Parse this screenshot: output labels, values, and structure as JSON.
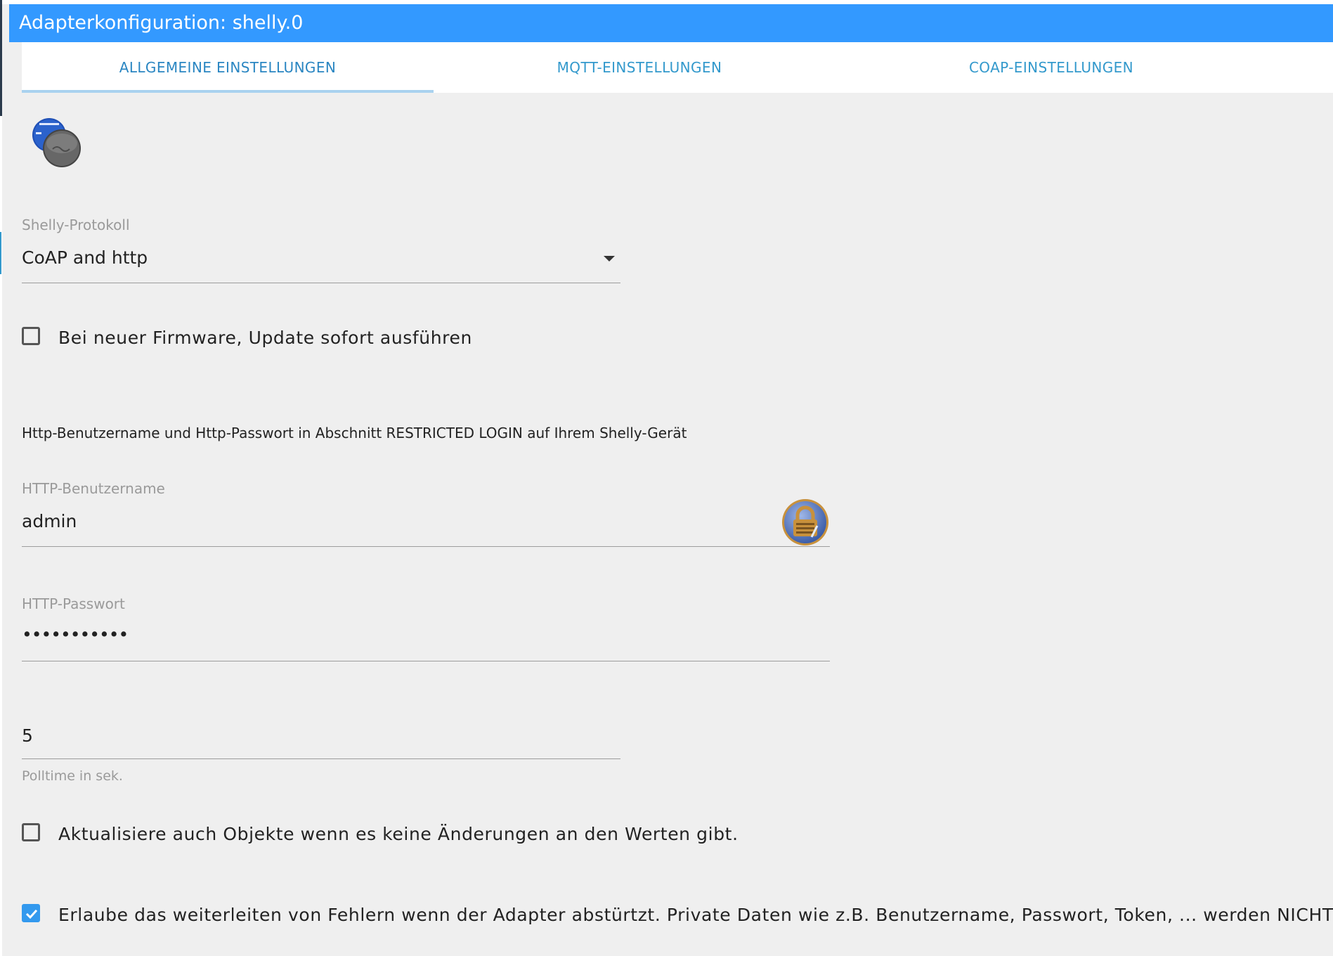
{
  "window": {
    "title": "Adapterkonfiguration: shelly.0"
  },
  "tabs": [
    {
      "label": "ALLGEMEINE EINSTELLUNGEN",
      "active": true
    },
    {
      "label": "MQTT-EINSTELLUNGEN",
      "active": false
    },
    {
      "label": "COAP-EINSTELLUNGEN",
      "active": false
    }
  ],
  "logo": {
    "icon": "shelly-device-logo-icon"
  },
  "protocol": {
    "label": "Shelly-Protokoll",
    "value": "CoAP and http"
  },
  "firmware_update": {
    "label": "Bei neuer Firmware, Update sofort ausführen",
    "checked": false
  },
  "http_note": "Http-Benutzername und Http-Passwort in Abschnitt RESTRICTED LOGIN auf Ihrem Shelly-Gerät",
  "http_user": {
    "label": "HTTP-Benutzername",
    "value": "admin",
    "icon": "keepass-lock-icon"
  },
  "http_password": {
    "label": "HTTP-Passwort",
    "value": "•••••••••••"
  },
  "polltime": {
    "value": "5",
    "helper": "Polltime in sek."
  },
  "update_unchanged": {
    "label": "Aktualisiere auch Objekte wenn es keine Änderungen an den Werten gibt.",
    "checked": false
  },
  "error_reporting": {
    "label": "Erlaube das weiterleiten von Fehlern wenn der Adapter abstürtzt. Private Daten wie z.B. Benutzername, Passwort, Token, ... werden NICHT übertragen.",
    "checked": true
  },
  "colors": {
    "titlebar": "#3399ff",
    "tab_text": "#3399cc",
    "tab_indicator": "#a9d2ef",
    "background": "#efefef",
    "checkbox_checked": "#3399ee"
  }
}
